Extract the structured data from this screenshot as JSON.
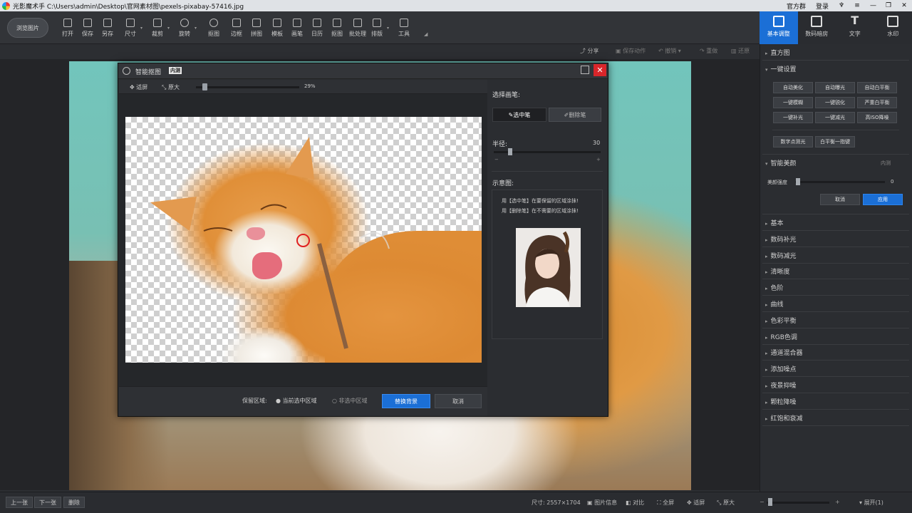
{
  "window": {
    "title": "光影魔术手 C:\\Users\\admin\\Desktop\\官网素材图\\pexels-pixabay-57416.jpg",
    "qq_group": "官方群",
    "login": "登录"
  },
  "toolbar": {
    "browse": "浏览图片",
    "tools": [
      "打开",
      "保存",
      "另存",
      "尺寸",
      "裁剪",
      "旋转",
      "抠图",
      "边框",
      "拼图",
      "模板",
      "画笔",
      "日历",
      "抠图",
      "批处理",
      "排版",
      "工具"
    ]
  },
  "right_tabs": [
    "基本调整",
    "数码暗房",
    "文字",
    "水印"
  ],
  "subbar": {
    "share": "分享",
    "save_action": "保存动作",
    "undo": "撤销",
    "redo": "重做",
    "restore": "还原"
  },
  "right_panel": {
    "histogram": "直方图",
    "one_click": "一键设置",
    "buttons": [
      "自动美化",
      "自动曝光",
      "自动白平衡",
      "一键模糊",
      "一键锐化",
      "严重白平衡",
      "一键补光",
      "一键减光",
      "高ISO降噪"
    ],
    "extra_buttons": [
      "数字点测光",
      "白平衡一指键"
    ],
    "smart_beauty": "智能美颜",
    "smart_beauty_tag": "内测",
    "beauty_label": "美颜强度",
    "beauty_value": "0",
    "cancel": "取消",
    "apply": "应用",
    "sections": [
      "基本",
      "数码补光",
      "数码减光",
      "清晰度",
      "色阶",
      "曲线",
      "色彩平衡",
      "RGB色调",
      "通道混合器",
      "添加噪点",
      "夜景抑噪",
      "颗粒降噪",
      "红饱和衰减"
    ]
  },
  "dialog": {
    "title": "智能抠图",
    "tag": "内测",
    "fit": "适屏",
    "actual": "原大",
    "zoom": "29%",
    "choose_brush": "选择画笔:",
    "select_brush": "选中笔",
    "delete_brush": "删除笔",
    "radius_label": "半径:",
    "radius_value": "30",
    "minus": "−",
    "plus": "+",
    "example_label": "示意图:",
    "hint1": "用【选中笔】在要保留的区域涂抹!",
    "hint2": "用【删除笔】在不需要的区域涂抹!",
    "keep_area": "保留区域:",
    "opt_selected": "当前选中区域",
    "opt_unselected": "非选中区域",
    "replace_bg": "替换背景",
    "cancel": "取消"
  },
  "status": {
    "prev": "上一张",
    "next": "下一张",
    "delete": "删除",
    "size": "尺寸: 2557×1704",
    "info": "图片信息",
    "compare": "对比",
    "fullscreen": "全屏",
    "fit": "适屏",
    "actual": "原大",
    "expand": "展开(1)"
  },
  "colors": {
    "accent": "#1b6fd6",
    "close": "#d8262a",
    "brush_circle": "#e02020"
  }
}
